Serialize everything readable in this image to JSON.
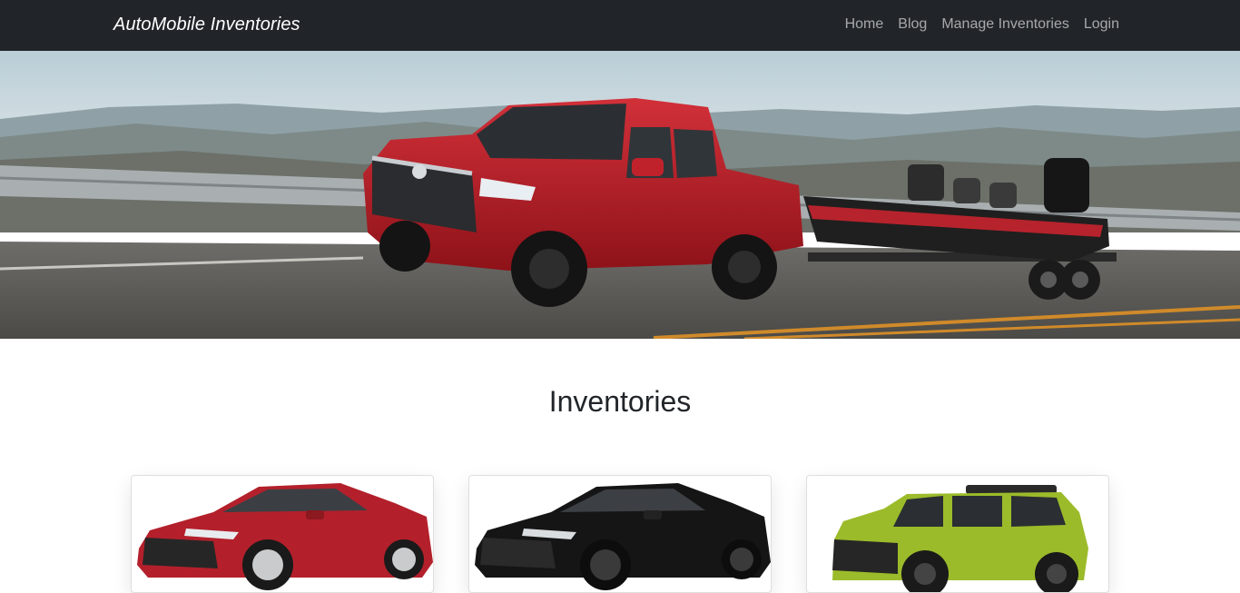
{
  "navbar": {
    "brand": "AutoMobile Inventories",
    "links": [
      "Home",
      "Blog",
      "Manage Inventories",
      "Login"
    ]
  },
  "hero": {
    "image": "red-pickup-truck-towing-boat"
  },
  "inventories": {
    "title": "Inventories",
    "cards": [
      {
        "image": "red-sedan",
        "color": "#b3202b"
      },
      {
        "image": "black-sedan",
        "color": "#151515"
      },
      {
        "image": "green-suv",
        "color": "#9cbb2a"
      }
    ]
  },
  "colors": {
    "navbar_bg": "#212529",
    "brand_text": "#ffffff",
    "nav_link": "rgba(255,255,255,0.6)"
  }
}
